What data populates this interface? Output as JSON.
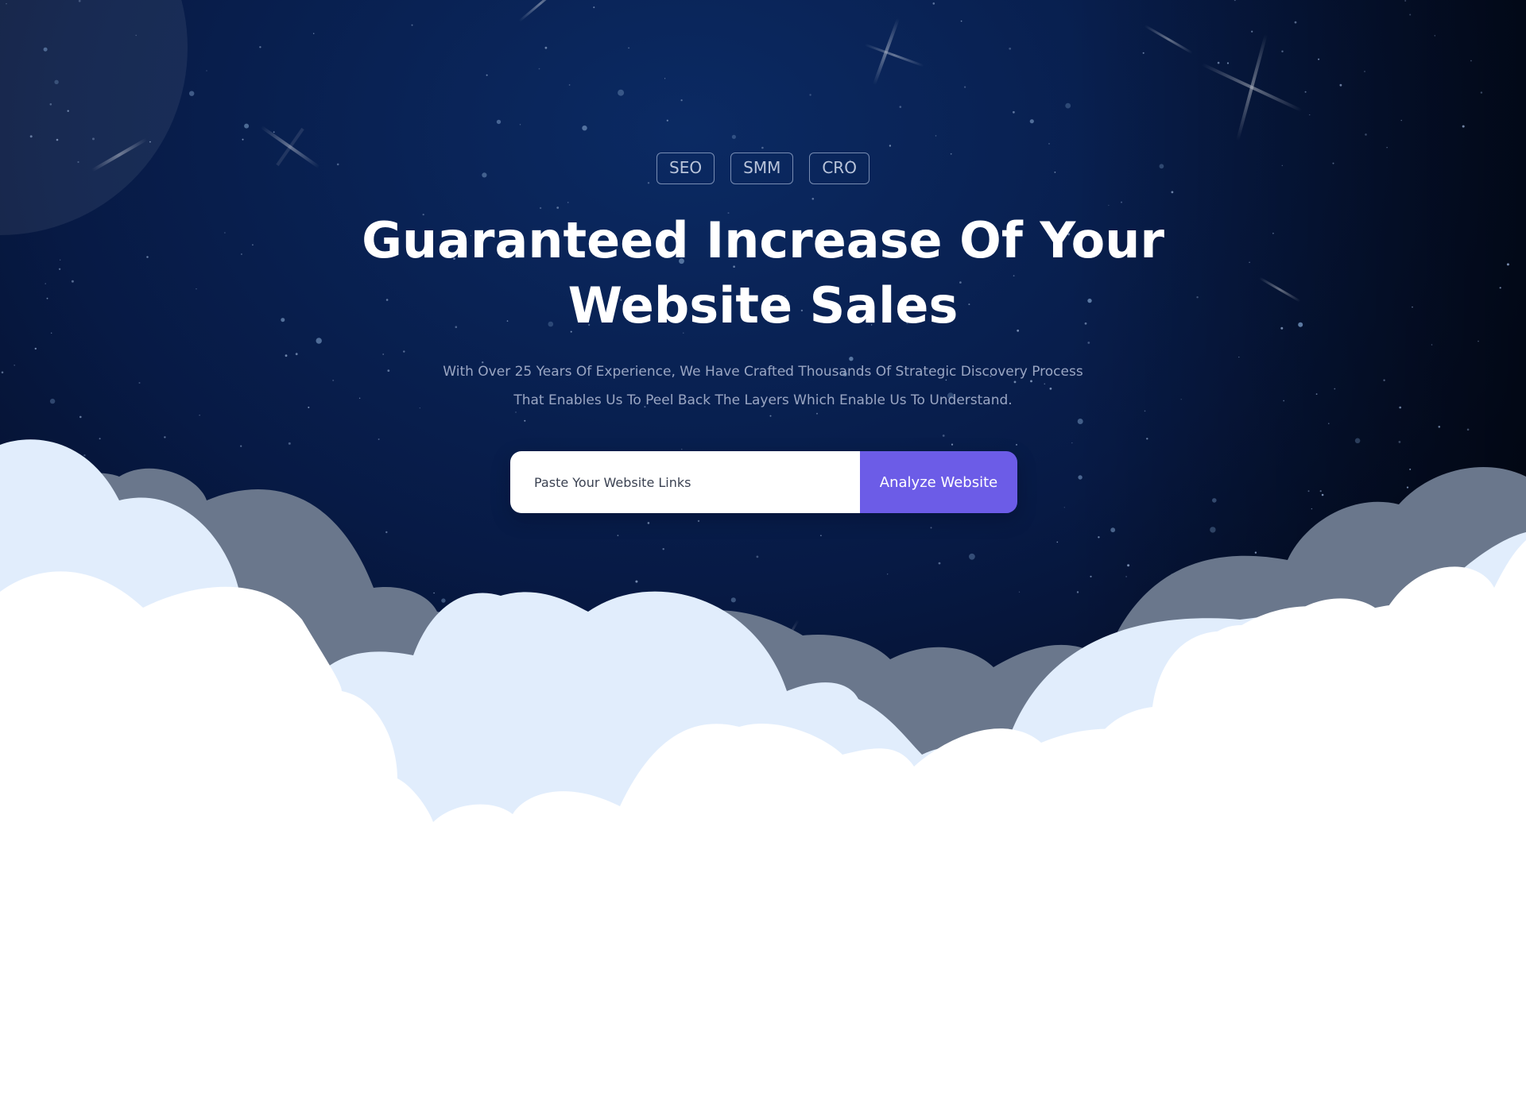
{
  "colors": {
    "sky_top": "#0b2a63",
    "sky_bottom": "#050d24",
    "cloud_back": "#6a778c",
    "cloud_mid": "#e1edfc",
    "cloud_front": "#ffffff",
    "accent": "#6c5ce7"
  },
  "hero": {
    "tags": [
      {
        "label": "SEO"
      },
      {
        "label": "SMM"
      },
      {
        "label": "CRO"
      }
    ],
    "headline": {
      "line1": "Guaranteed Increase Of Your",
      "line2": "Website Sales"
    },
    "subtitle": {
      "line1": "With Over 25 Years Of Experience, We Have Crafted Thousands Of Strategic Discovery Process",
      "line2": "That Enables Us To Peel Back The Layers Which Enable Us To Understand."
    },
    "form": {
      "input_placeholder": "Paste Your Website Links",
      "button_label": "Analyze Website"
    }
  },
  "decorations": {
    "background_icons": [
      "moon-icon",
      "star-icon",
      "sparkle-icon",
      "cloud-icon"
    ]
  }
}
